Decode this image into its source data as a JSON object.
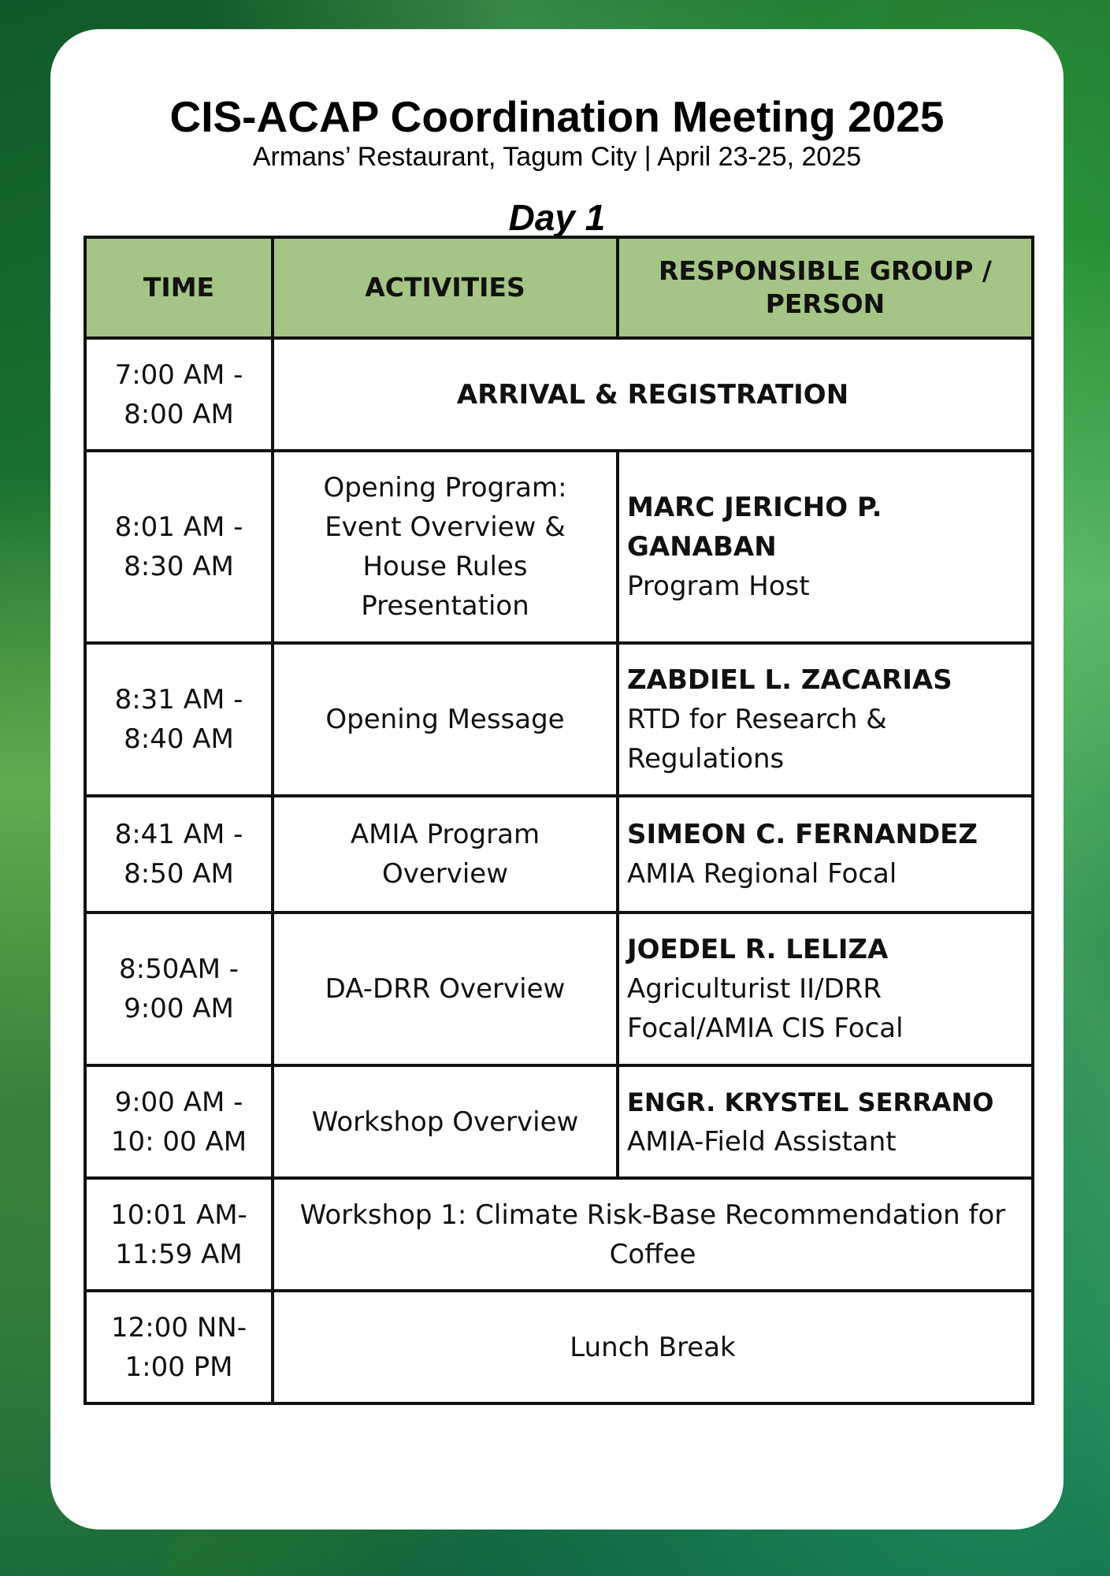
{
  "header": {
    "title": "CIS-ACAP Coordination Meeting 2025",
    "subtitle": "Armans’ Restaurant, Tagum City | April 23-25, 2025",
    "day": "Day 1"
  },
  "table": {
    "columns": {
      "time": "TIME",
      "activities": "ACTIVITIES",
      "responsible": "RESPONSIBLE GROUP / PERSON"
    },
    "rows": [
      {
        "time_start": "7:00 AM -",
        "time_end": "8:00 AM",
        "activity": "ARRIVAL & REGISTRATION"
      },
      {
        "time_start": "8:01 AM -",
        "time_end": "8:30 AM",
        "activity": "Opening Program: Event Overview & House Rules Presentation",
        "name": "MARC JERICHO P. GANABAN",
        "role": "Program Host"
      },
      {
        "time_start": "8:31 AM -",
        "time_end": "8:40 AM",
        "activity": "Opening Message",
        "name": "ZABDIEL L. ZACARIAS",
        "role": "RTD for Research & Regulations"
      },
      {
        "time_start": "8:41 AM -",
        "time_end": "8:50 AM",
        "activity": "AMIA Program Overview",
        "name": "SIMEON C. FERNANDEZ",
        "role": "AMIA Regional Focal"
      },
      {
        "time_start": "8:50AM -",
        "time_end": "9:00 AM",
        "activity": "DA-DRR Overview",
        "name": "JOEDEL R. LELIZA",
        "role": "Agriculturist II/DRR Focal/AMIA CIS Focal"
      },
      {
        "time_start": "9:00 AM -",
        "time_end": "10: 00 AM",
        "activity": "Workshop Overview",
        "name": "ENGR. KRYSTEL SERRANO",
        "role": "AMIA-Field Assistant"
      },
      {
        "time_start": "10:01 AM-",
        "time_end": "11:59 AM",
        "activity": "Workshop 1: Climate Risk-Base Recommendation for Coffee"
      },
      {
        "time_start": "12:00 NN-",
        "time_end": "1:00 PM",
        "activity": "Lunch Break"
      }
    ]
  }
}
